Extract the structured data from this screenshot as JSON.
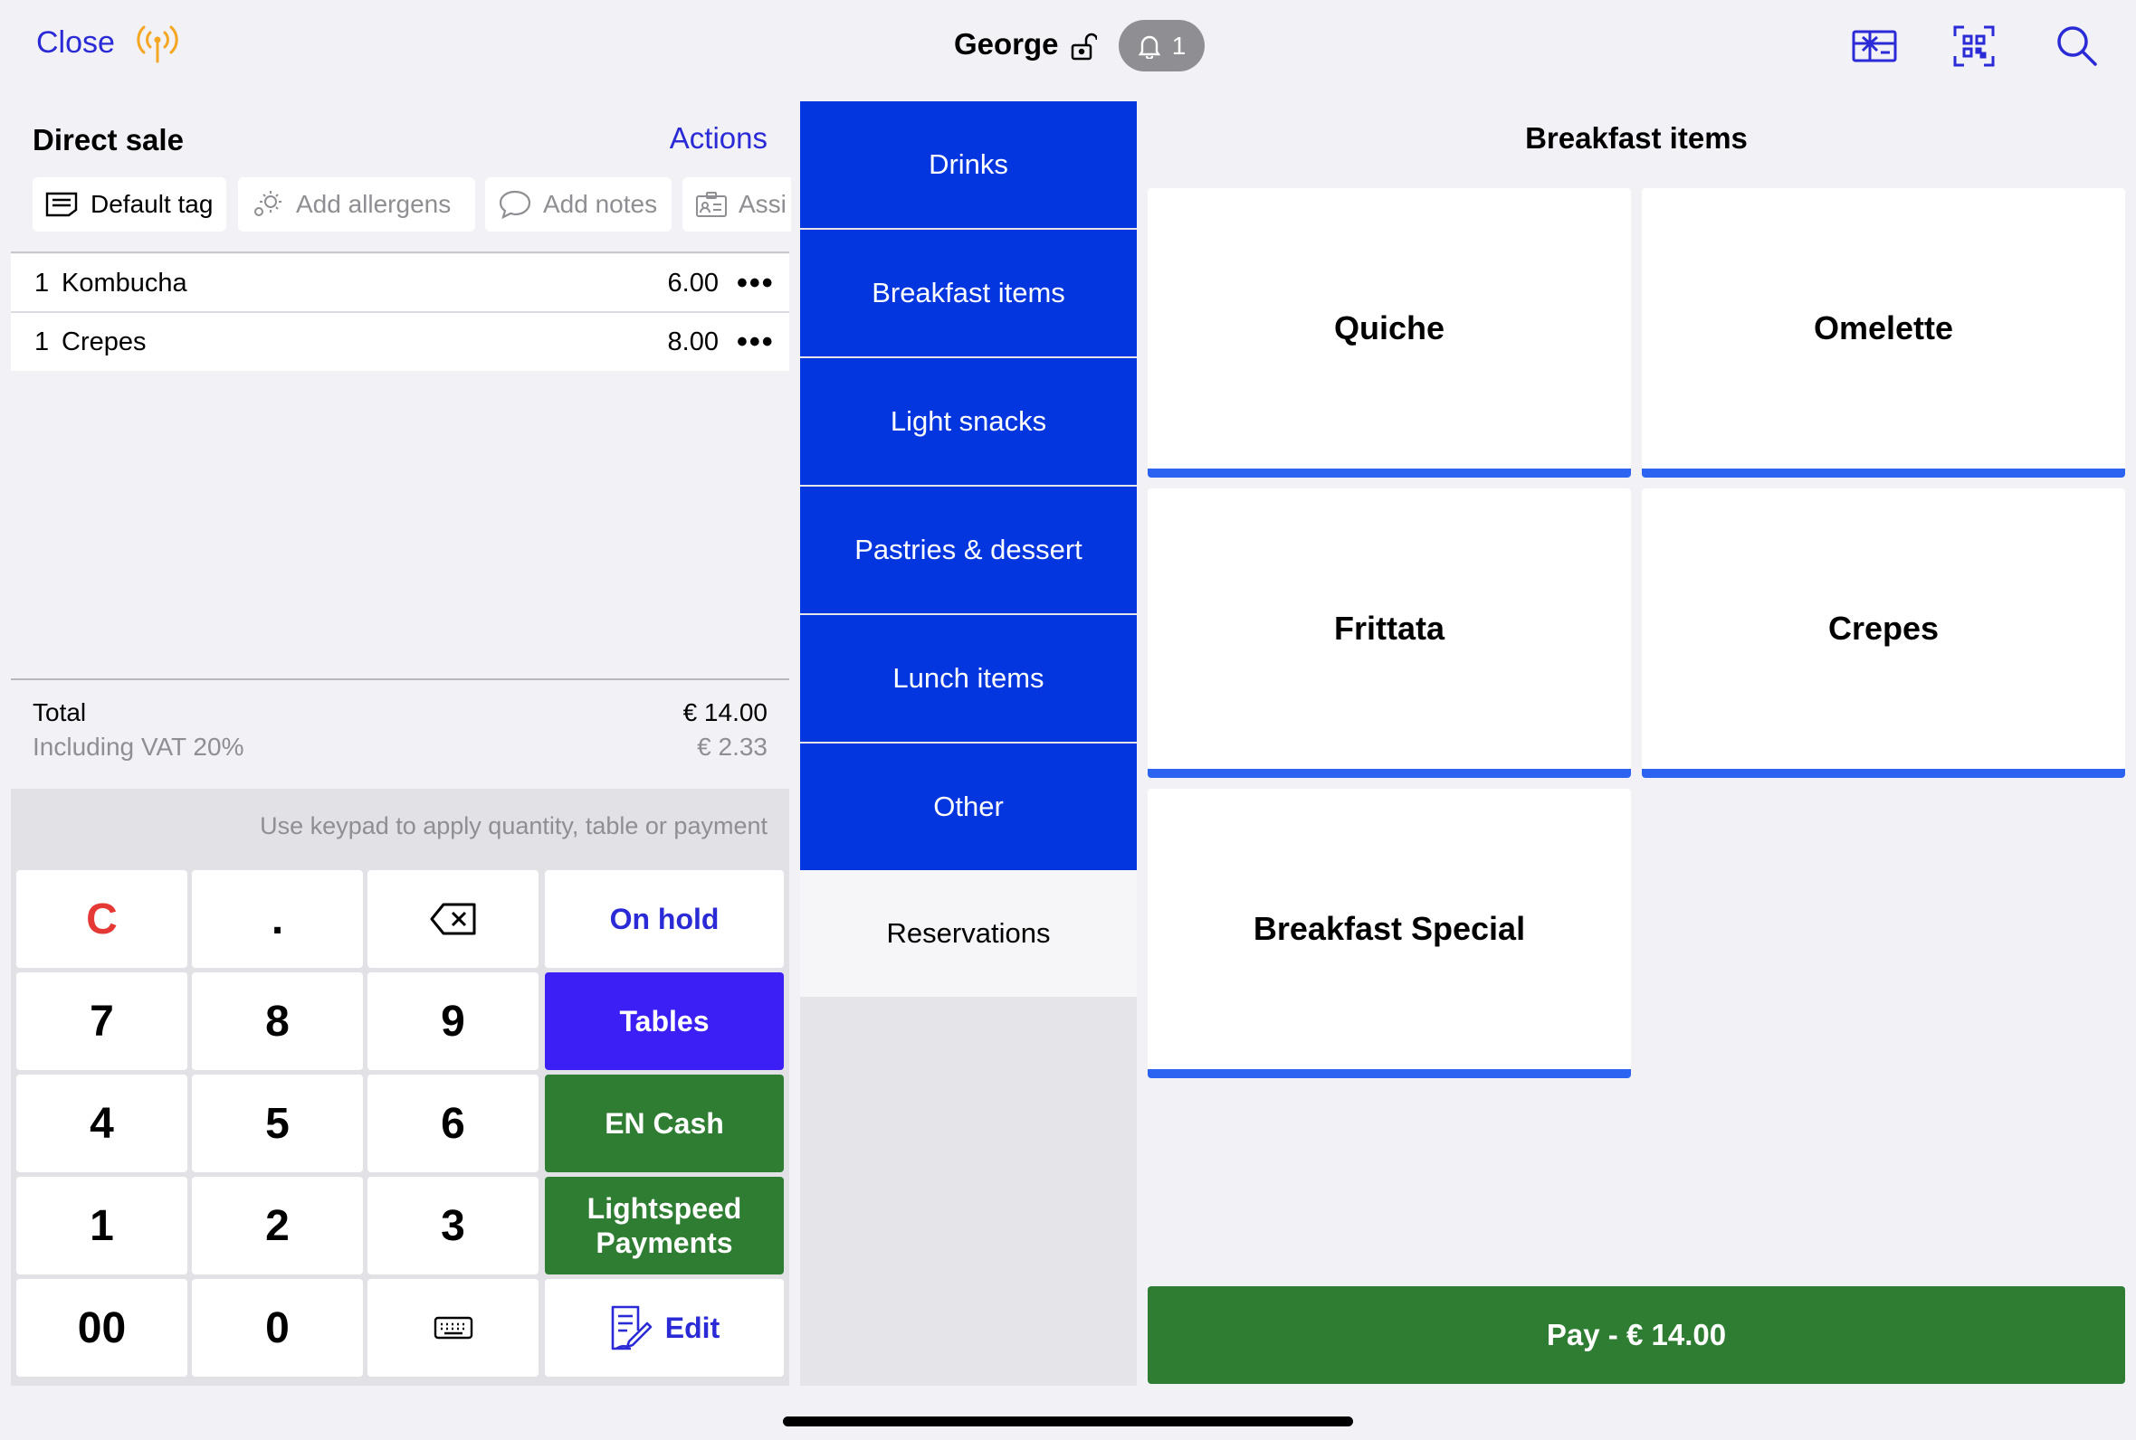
{
  "header": {
    "close_label": "Close",
    "user_name": "George",
    "notification_count": "1"
  },
  "order": {
    "title": "Direct sale",
    "actions_label": "Actions",
    "chips": {
      "default_tag": "Default tag",
      "add_allergens": "Add allergens",
      "add_notes": "Add notes",
      "assign": "Assi"
    },
    "lines": [
      {
        "qty": "1",
        "name": "Kombucha",
        "price": "6.00",
        "more": "•••"
      },
      {
        "qty": "1",
        "name": "Crepes",
        "price": "8.00",
        "more": "•••"
      }
    ],
    "total_label": "Total",
    "total_value": "€ 14.00",
    "vat_label": "Including VAT 20%",
    "vat_value": "€ 2.33"
  },
  "keypad": {
    "hint": "Use keypad to apply quantity, table or payment",
    "clear": "C",
    "dot": ".",
    "on_hold": "On hold",
    "tables": "Tables",
    "cash": "EN Cash",
    "lightspeed_line1": "Lightspeed",
    "lightspeed_line2": "Payments",
    "edit": "Edit",
    "digits": [
      "7",
      "8",
      "9",
      "4",
      "5",
      "6",
      "1",
      "2",
      "3",
      "00",
      "0"
    ]
  },
  "categories": [
    "Drinks",
    "Breakfast items",
    "Light snacks",
    "Pastries & dessert",
    "Lunch items",
    "Other",
    "Reservations"
  ],
  "products": {
    "title": "Breakfast items",
    "items": [
      "Quiche",
      "Omelette",
      "Frittata",
      "Crepes",
      "Breakfast Special"
    ]
  },
  "pay_label": "Pay - € 14.00",
  "colors": {
    "accent_blue": "#2a2ad6",
    "category_blue": "#0336df",
    "tables_purple": "#3b1ff5",
    "green": "#2e7d32",
    "clear_red": "#e53935",
    "signal_orange": "#f5a623"
  }
}
